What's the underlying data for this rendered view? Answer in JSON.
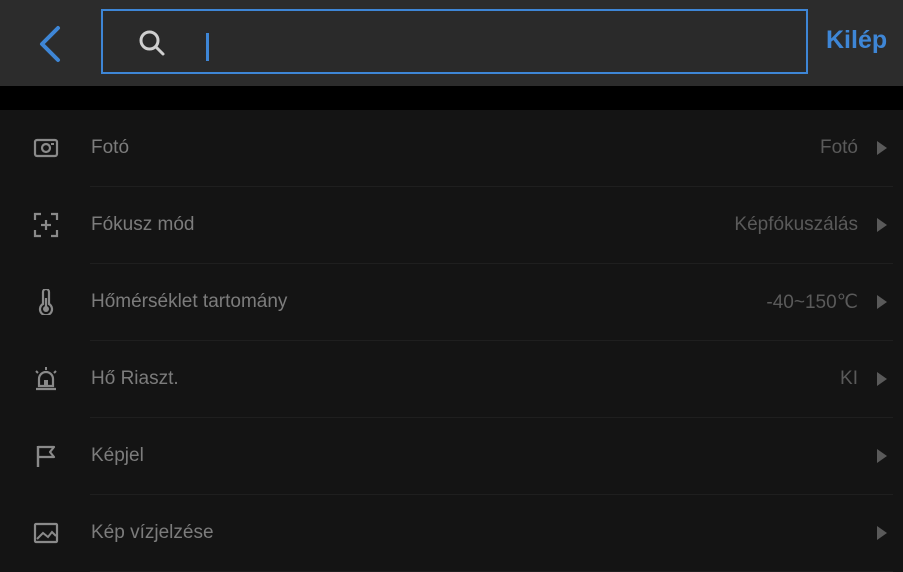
{
  "header": {
    "back_icon": "chevron-left-icon",
    "search_icon": "search-icon",
    "search_value": "",
    "search_placeholder": "",
    "exit_label": "Kilép",
    "accent_color": "#3e86d6"
  },
  "settings": {
    "items": [
      {
        "icon": "camera-icon",
        "label": "Fotó",
        "value": "Fotó"
      },
      {
        "icon": "focus-icon",
        "label": "Fókusz mód",
        "value": "Képfókuszálás"
      },
      {
        "icon": "thermometer-icon",
        "label": "Hőmérséklet tartomány",
        "value": "-40~150℃"
      },
      {
        "icon": "alarm-icon",
        "label": "Hő Riaszt.",
        "value": "KI"
      },
      {
        "icon": "flag-icon",
        "label": "Képjel",
        "value": ""
      },
      {
        "icon": "image-icon",
        "label": "Kép vízjelzése",
        "value": ""
      }
    ]
  }
}
